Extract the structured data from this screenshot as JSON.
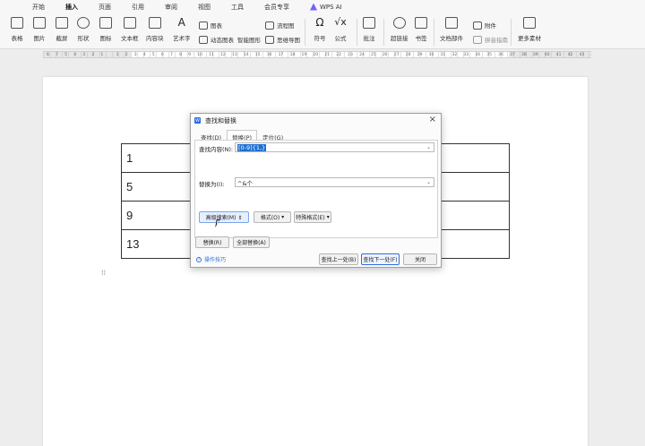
{
  "menu": {
    "items": [
      "开始",
      "插入",
      "页面",
      "引用",
      "审阅",
      "视图",
      "工具",
      "会员专享"
    ],
    "active": "插入",
    "wps_ai": "WPS AI"
  },
  "ribbon": {
    "table": "表格",
    "picture": "图片",
    "screenshot": "截屏",
    "shape": "形状",
    "icon": "图标",
    "textbox": "文本框",
    "content": "内容块",
    "wordart": "艺术字",
    "chart": "图表",
    "flowchart": "流程图",
    "mindmap": "思维导图",
    "dynamic_chart": "动态图表",
    "smart_shape": "智能图形",
    "symbol": "符号",
    "formula": "公式",
    "annotation": "批注",
    "hyperlink": "超链接",
    "bookmark": "书签",
    "doc_parts": "文档部件",
    "attachment": "附件",
    "pinyin": "拼音指南",
    "more": "更多素材"
  },
  "ruler_numbers": [
    "6",
    "7",
    "5",
    "4",
    "3",
    "2",
    "1",
    "",
    "1",
    "2",
    "3",
    "4",
    "5",
    "6",
    "7",
    "8",
    "9",
    "10",
    "11",
    "12",
    "13",
    "14",
    "15",
    "16",
    "17",
    "18",
    "19",
    "20",
    "21",
    "22",
    "23",
    "24",
    "25",
    "26",
    "27",
    "28",
    "29",
    "30",
    "31",
    "32",
    "33",
    "34",
    "35",
    "36",
    "37",
    "38",
    "39",
    "40",
    "41",
    "42",
    "43",
    "44",
    "45",
    "46",
    "47"
  ],
  "document": {
    "cells": [
      "1",
      "5",
      "9",
      "13"
    ]
  },
  "dialog": {
    "title": "查找和替换",
    "tabs": [
      "查找(D)",
      "替换(P)",
      "定位(G)"
    ],
    "active_tab": "替换(P)",
    "find_label": "查找内容(N):",
    "find_value": "[0-9]{1,}",
    "replace_label": "替换为(I):",
    "replace_value": "^&个",
    "advanced_search": "高级搜索(M) ⇕",
    "format": "格式(O)",
    "special_format": "特殊格式(E)",
    "replace_btn": "替换(R)",
    "replace_all_btn": "全部替换(A)",
    "tip": "操作技巧",
    "find_prev": "查找上一处(B)",
    "find_next": "查找下一处(F)",
    "close": "关闭"
  }
}
